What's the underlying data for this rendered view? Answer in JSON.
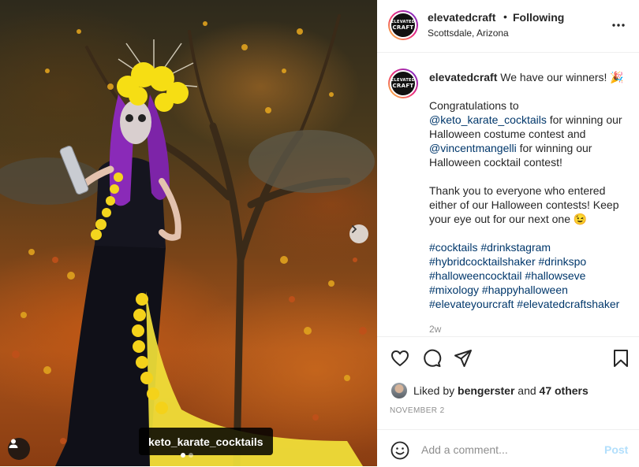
{
  "photo": {
    "tag_label": "keto_karate_cocktails",
    "next_icon": "chevron-right-icon",
    "user_tag_icon": "person-icon",
    "carousel_dots": [
      "active",
      "inactive"
    ]
  },
  "header": {
    "username": "elevatedcraft",
    "separator": "•",
    "follow_label": "Following",
    "location": "Scottsdale, Arizona",
    "more_icon": "more-horizontal-icon",
    "avatar_text_top": "ELEVATED",
    "avatar_text_bottom": "CRAFT"
  },
  "caption": {
    "username": "elevatedcraft",
    "intro": "We have our winners! 🎉",
    "p1_pre": "Congratulations to",
    "mention1": "@keto_karate_cocktails",
    "p1_mid": "for winning our Halloween costume contest and",
    "mention2": "@vincentmangelli",
    "p1_post": "for winning our Halloween cocktail contest!",
    "p2": "Thank you to everyone who entered either of our Halloween contests! Keep your eye out for our next one 😉",
    "hashtags": [
      "#cocktails",
      "#drinkstagram",
      "#hybridcocktailshaker",
      "#drinkspo",
      "#halloweencocktail",
      "#hallowseve",
      "#mixology",
      "#happyhalloween",
      "#elevateyourcraft",
      "#elevatedcraftshaker"
    ],
    "time": "2w"
  },
  "actions": {
    "like_icon": "heart-icon",
    "comment_icon": "comment-icon",
    "share_icon": "paper-plane-icon",
    "save_icon": "bookmark-icon"
  },
  "likes": {
    "prefix": "Liked by",
    "user": "bengerster",
    "joiner": "and",
    "others": "47 others"
  },
  "date": "NOVEMBER 2",
  "comment": {
    "emoji_icon": "smiley-icon",
    "placeholder": "Add a comment...",
    "post_label": "Post"
  },
  "colors": {
    "link": "#00376b",
    "muted": "#8e8e8e",
    "post_disabled": "#b2dffc",
    "divider": "#efefef"
  }
}
